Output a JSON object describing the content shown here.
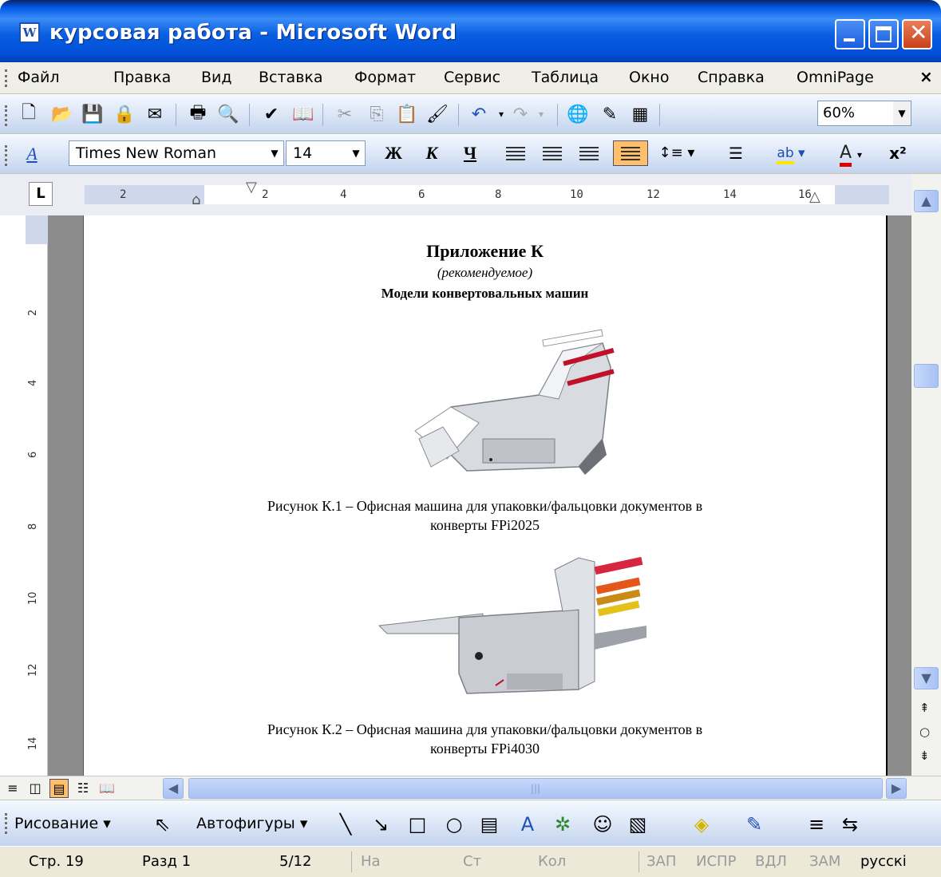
{
  "window": {
    "title": "курсовая работа - Microsoft Word",
    "icon": "word-document-icon",
    "buttons": [
      "minimize",
      "maximize",
      "close"
    ]
  },
  "menubar": {
    "items": [
      "Файл",
      "Правка",
      "Вид",
      "Вставка",
      "Формат",
      "Сервис",
      "Таблица",
      "Окно",
      "Справка",
      "OmniPage"
    ],
    "close_symbol": "×"
  },
  "standard_toolbar": {
    "icons": [
      "new-document-icon",
      "open-folder-icon",
      "save-icon",
      "permission-icon",
      "print-preview-icon",
      "print-icon",
      "preview-icon",
      "spelling-icon",
      "research-icon",
      "cut-icon",
      "copy-icon",
      "paste-icon",
      "format-painter-icon",
      "undo-icon",
      "redo-icon",
      "hyperlink-icon",
      "tables-borders-icon",
      "insert-table-icon"
    ],
    "zoom": "60%"
  },
  "formatting_toolbar": {
    "style_icon": "styles-icon",
    "font": "Times New Roman",
    "size": "14",
    "bold": "Ж",
    "italic": "К",
    "underline": "Ч",
    "superscript": "x²",
    "font_color_label": "A",
    "highlight_label": "ab"
  },
  "ruler": {
    "labels": [
      "2",
      "2",
      "4",
      "6",
      "8",
      "10",
      "12",
      "14",
      "16"
    ],
    "vertical_labels": [
      "2",
      "4",
      "6",
      "8",
      "10",
      "12",
      "14"
    ]
  },
  "document": {
    "heading": "Приложение К",
    "subheading": "(рекомендуемое)",
    "section_title": "Модели конвертовальных машин",
    "figure1_caption_line1": "Рисунок К.1 – Офисная машина для упаковки/фальцовки документов в",
    "figure1_caption_line2": "конверты FPi2025",
    "figure2_caption_line1": "Рисунок К.2 – Офисная машина для упаковки/фальцовки документов в",
    "figure2_caption_line2": "конверты FPi4030"
  },
  "drawing_toolbar": {
    "draw_menu": "Рисование",
    "autoshapes_menu": "Автофигуры"
  },
  "statusbar": {
    "page": "Стр. 19",
    "section": "Разд 1",
    "pages": "5/12",
    "at": "На",
    "line": "Ст",
    "column": "Кол",
    "rec": "ЗАП",
    "trk": "ИСПР",
    "ext": "ВДЛ",
    "ovr": "ЗАМ",
    "language": "русскі"
  },
  "colors": {
    "titlebar": "#0058e6",
    "toolbar": "#c3d4ee",
    "active_button": "#ffc069",
    "page_background": "#8c8c8c"
  }
}
